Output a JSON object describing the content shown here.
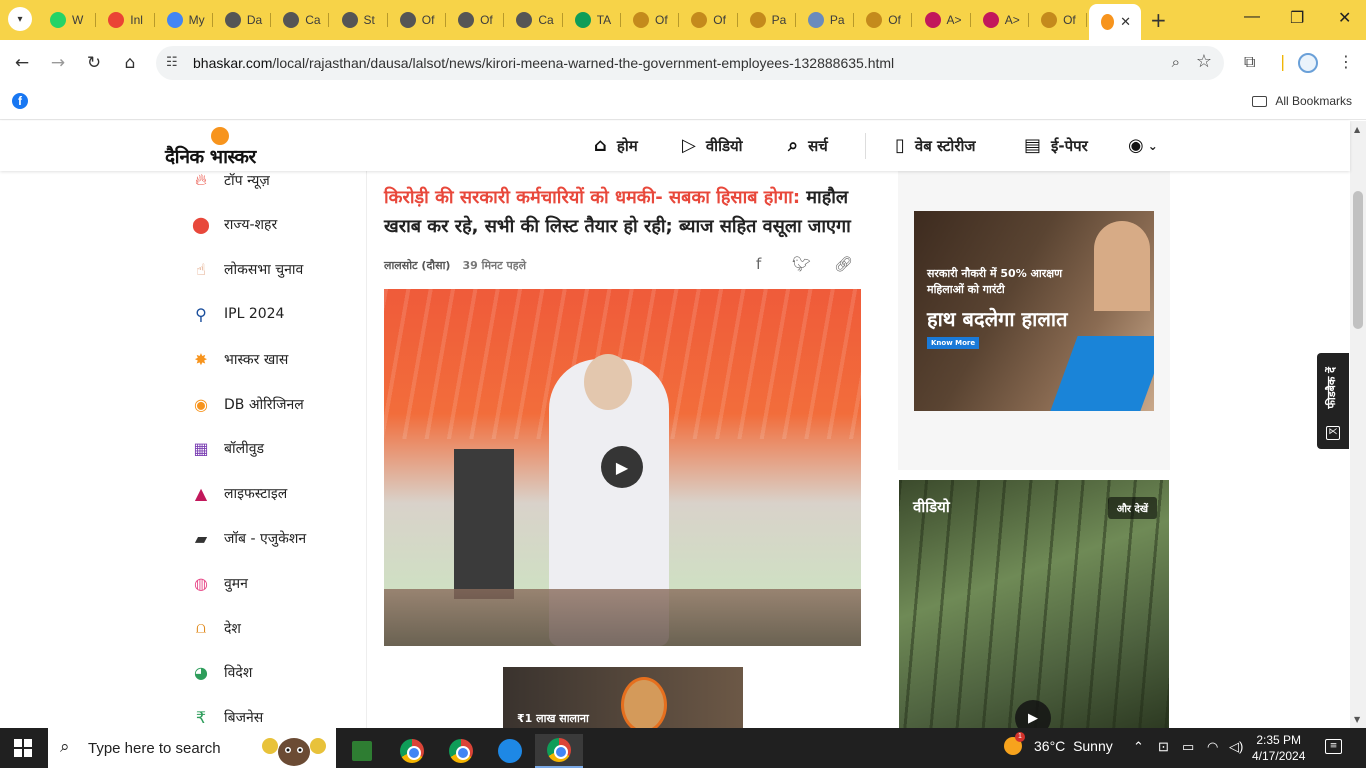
{
  "browser": {
    "tabs": [
      {
        "label": "W",
        "icon": "whatsapp-icon",
        "color": "#25d366"
      },
      {
        "label": "Inl",
        "icon": "gmail-icon",
        "color": "#ea4335"
      },
      {
        "label": "My",
        "icon": "app-icon",
        "color": "#4285f4"
      },
      {
        "label": "Da",
        "icon": "generic-tab-icon",
        "color": "#555555"
      },
      {
        "label": "Ca",
        "icon": "generic-tab-icon",
        "color": "#555555"
      },
      {
        "label": "St",
        "icon": "generic-tab-icon",
        "color": "#555555"
      },
      {
        "label": "Of",
        "icon": "generic-tab-icon",
        "color": "#555555"
      },
      {
        "label": "Of",
        "icon": "generic-tab-icon",
        "color": "#555555"
      },
      {
        "label": "Ca",
        "icon": "generic-tab-icon",
        "color": "#555555"
      },
      {
        "label": "TA",
        "icon": "sheets-icon",
        "color": "#0f9d58"
      },
      {
        "label": "Of",
        "icon": "generic-tab-icon",
        "color": "#c48a1c"
      },
      {
        "label": "Of",
        "icon": "generic-tab-icon",
        "color": "#c48a1c"
      },
      {
        "label": "Pa",
        "icon": "generic-tab-icon",
        "color": "#c48a1c"
      },
      {
        "label": "Pa",
        "icon": "app-icon",
        "color": "#6a8bbd"
      },
      {
        "label": "Of",
        "icon": "generic-tab-icon",
        "color": "#c48a1c"
      },
      {
        "label": "A>",
        "icon": "a-icon",
        "color": "#c2185b"
      },
      {
        "label": "A>",
        "icon": "a-icon",
        "color": "#c2185b"
      },
      {
        "label": "Of",
        "icon": "generic-tab-icon",
        "color": "#c48a1c"
      }
    ],
    "active_tab_icon_color": "#f7941d",
    "url_domain": "bhaskar.com",
    "url_path": "/local/rajasthan/dausa/lalsot/news/kirori-meena-warned-the-government-employees-132888635.html",
    "all_bookmarks": "All Bookmarks"
  },
  "site": {
    "logo_text": "दैनिक भास्कर",
    "nav": [
      {
        "label": "होम",
        "icon": "home-icon"
      },
      {
        "label": "वीडियो",
        "icon": "play-circle-icon"
      },
      {
        "label": "सर्च",
        "icon": "search-icon"
      },
      {
        "label": "वेब स्टोरीज",
        "icon": "stories-icon"
      },
      {
        "label": "ई-पेपर",
        "icon": "epaper-icon"
      }
    ]
  },
  "sidebar": {
    "items": [
      {
        "label": "टॉप न्यूज़",
        "icon": "fire-icon"
      },
      {
        "label": "राज्य-शहर",
        "icon": "location-pin-icon"
      },
      {
        "label": "लोकसभा चुनाव",
        "icon": "finger-ink-icon"
      },
      {
        "label": "IPL 2024",
        "icon": "cricket-icon"
      },
      {
        "label": "भास्कर खास",
        "icon": "star-burst-icon"
      },
      {
        "label": "DB ओरिजिनल",
        "icon": "db-original-icon"
      },
      {
        "label": "बॉलीवुड",
        "icon": "clapperboard-icon"
      },
      {
        "label": "लाइफस्टाइल",
        "icon": "lifestyle-icon"
      },
      {
        "label": "जॉब - एजुकेशन",
        "icon": "graduation-cap-icon"
      },
      {
        "label": "वुमन",
        "icon": "woman-icon"
      },
      {
        "label": "देश",
        "icon": "india-gate-icon"
      },
      {
        "label": "विदेश",
        "icon": "globe-icon"
      },
      {
        "label": "बिजनेस",
        "icon": "rupee-icon"
      }
    ]
  },
  "article": {
    "headline_red": "किरोड़ी की सरकारी कर्मचारियों को धमकी- सबका हिसाब होगा:",
    "headline_black": " माहौल खराब कर रहे, सभी की लिस्ट तैयार हो रही; ब्याज सहित वसूला जाएगा",
    "location": "लालसोट (दौसा)",
    "time": "39 मिनट पहले",
    "bottom_ad_text": "₹1 लाख सालाना"
  },
  "right": {
    "ad_line1": "सरकारी नौकरी में 50% आरक्षण महिलाओं को गारंटी",
    "ad_line2": "हाथ बदलेगा हालात",
    "ad_cta": "Know More",
    "video_title": "वीडियो",
    "video_more": "और देखें"
  },
  "feedback": {
    "label": "फीडबैक दें"
  },
  "taskbar": {
    "search_placeholder": "Type here to search",
    "temperature": "36°C",
    "weather": "Sunny",
    "time": "2:35 PM",
    "date": "4/17/2024"
  },
  "colors": {
    "tabstrip": "#f7d348",
    "headline_red": "#e8483b",
    "brand_orange": "#f7941d"
  }
}
